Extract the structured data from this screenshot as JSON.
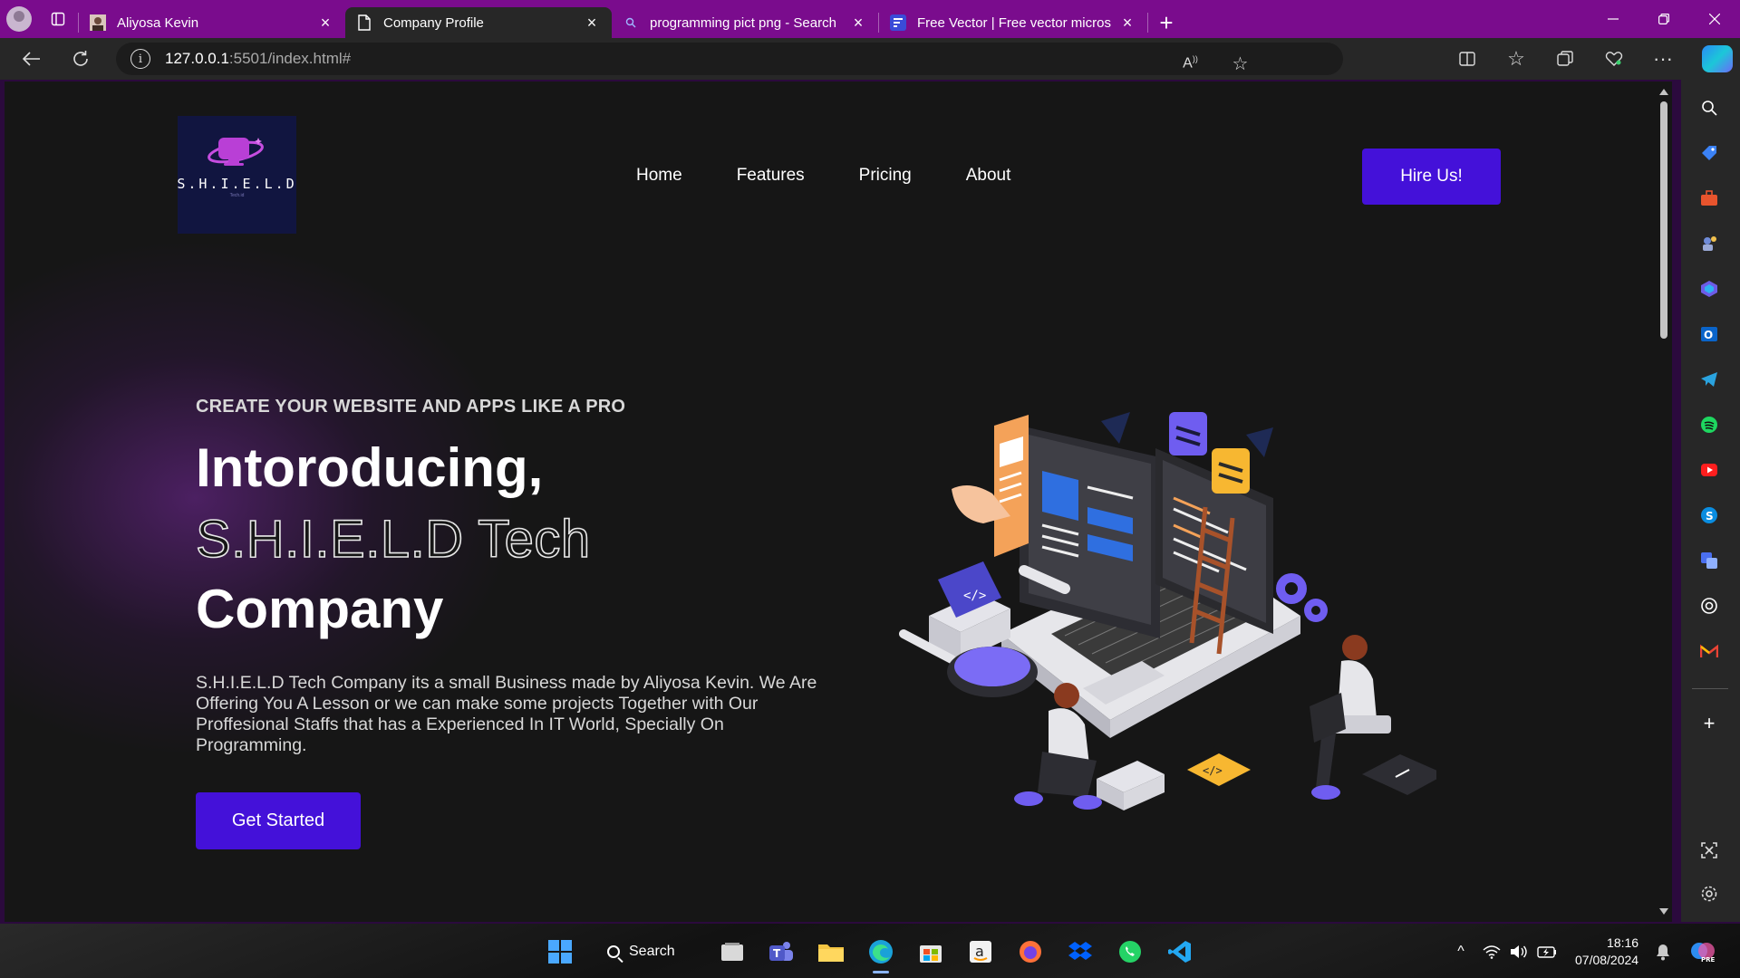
{
  "browser": {
    "tabs": [
      {
        "title": "Aliyosa Kevin",
        "icon": "person-photo-icon",
        "active": false
      },
      {
        "title": "Company Profile",
        "icon": "document-icon",
        "active": true
      },
      {
        "title": "programming pict png - Search",
        "icon": "search-icon",
        "active": false
      },
      {
        "title": "Free Vector | Free vector microsit",
        "icon": "freepik-icon",
        "active": false
      }
    ],
    "url_host": "127.0.0.1",
    "url_path": ":5501/index.html#",
    "accent_color": "#7a0c8d"
  },
  "site": {
    "logo_text": "S.H.I.E.L.D",
    "logo_subtext": "Tech.id",
    "nav": [
      "Home",
      "Features",
      "Pricing",
      "About"
    ],
    "cta_header": "Hire Us!",
    "eyebrow": "CREATE YOUR WEBSITE AND APPS LIKE A PRO",
    "headline_1": "Intoroducing,",
    "headline_2": "S.H.I.E.L.D Tech",
    "headline_3": "Company",
    "description": "S.H.I.E.L.D Tech Company its a small Business made by Aliyosa Kevin. We Are Offering You A Lesson or we can make some projects Together with Our Proffesional Staffs that has a Experienced In IT World, Specially On Programming.",
    "cta_main": "Get Started",
    "button_color": "#4411d9"
  },
  "taskbar": {
    "search_label": "Search",
    "time": "18:16",
    "date": "07/08/2024"
  }
}
